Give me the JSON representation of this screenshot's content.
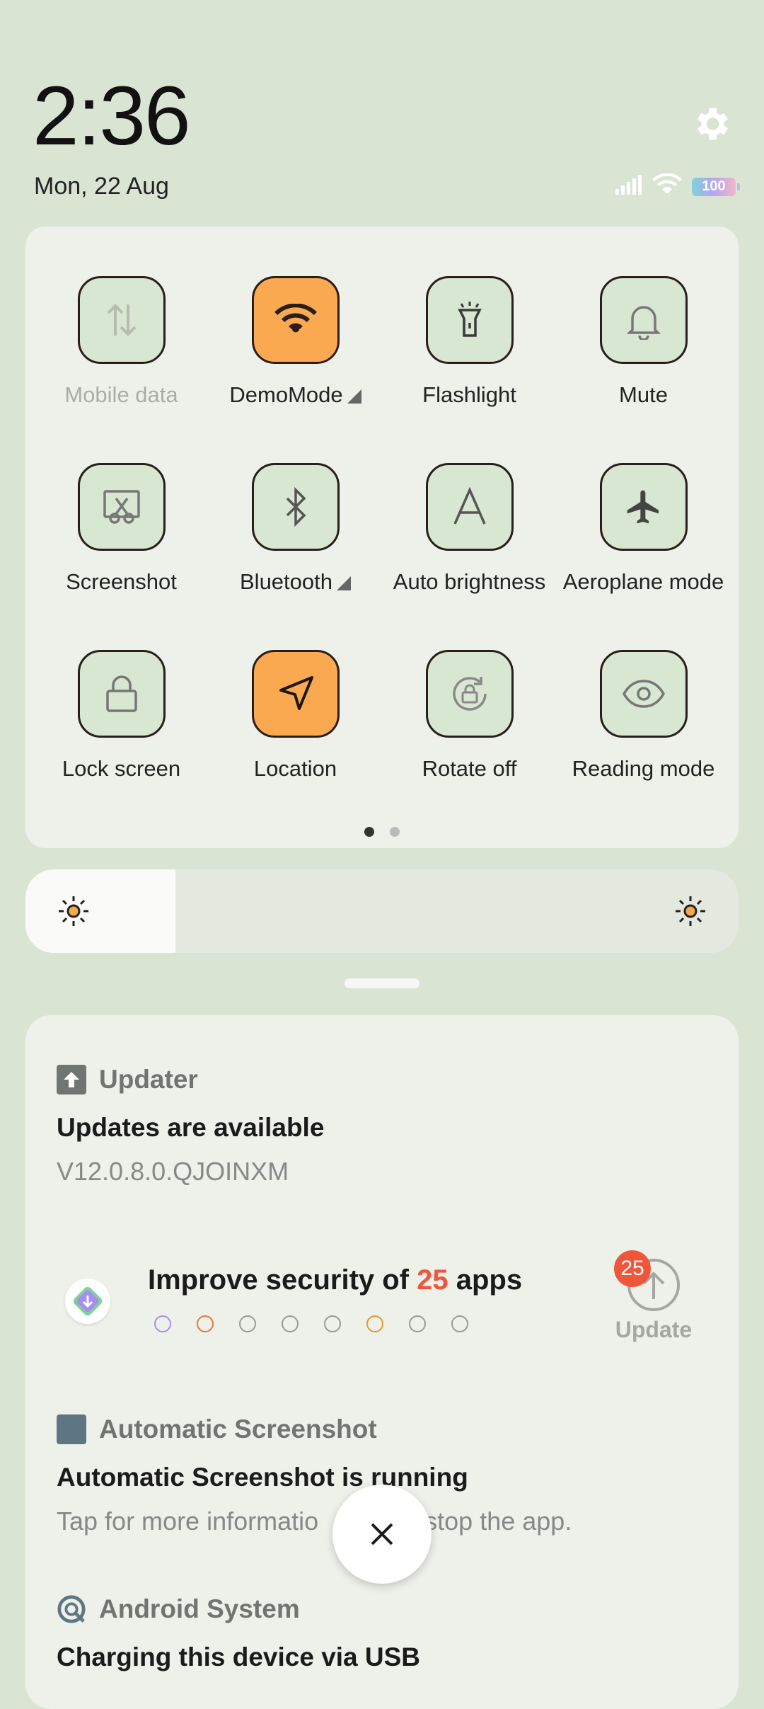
{
  "header": {
    "time": "2:36",
    "date": "Mon, 22 Aug",
    "battery": "100"
  },
  "quick_settings": {
    "tiles": [
      {
        "label": "Mobile data",
        "state": "disabled",
        "icon": "mobile-data-icon"
      },
      {
        "label": "DemoMode",
        "state": "on",
        "icon": "wifi-icon"
      },
      {
        "label": "Flashlight",
        "state": "off",
        "icon": "flashlight-icon"
      },
      {
        "label": "Mute",
        "state": "off",
        "icon": "bell-icon"
      },
      {
        "label": "Screenshot",
        "state": "off",
        "icon": "scissors-icon"
      },
      {
        "label": "Bluetooth",
        "state": "off",
        "icon": "bluetooth-icon"
      },
      {
        "label": "Auto brightness",
        "state": "off",
        "icon": "auto-brightness-icon"
      },
      {
        "label": "Aeroplane mode",
        "state": "off",
        "icon": "airplane-icon"
      },
      {
        "label": "Lock screen",
        "state": "off",
        "icon": "lock-icon"
      },
      {
        "label": "Location",
        "state": "on",
        "icon": "location-icon"
      },
      {
        "label": "Rotate off",
        "state": "off",
        "icon": "rotate-lock-icon"
      },
      {
        "label": "Reading mode",
        "state": "off",
        "icon": "eye-icon"
      }
    ],
    "page_index": 1,
    "page_count": 2
  },
  "brightness": {
    "level": 0.21
  },
  "notifications": {
    "updater": {
      "app": "Updater",
      "title": "Updates are available",
      "body": "V12.0.8.0.QJOINXM"
    },
    "security": {
      "title_prefix": "Improve security of ",
      "count": "25",
      "title_suffix": " apps",
      "button": "Update",
      "badge": "25"
    },
    "auto_screenshot": {
      "app": "Automatic Screenshot",
      "title": "Automatic Screenshot is running",
      "body": "Tap for more informatio",
      "body_right": "stop the app."
    },
    "android": {
      "app": "Android System",
      "title": "Charging this device via USB"
    }
  },
  "colors": {
    "accent_on": "#fba950",
    "badge": "#f0563a",
    "background": "#d9e4d3"
  }
}
